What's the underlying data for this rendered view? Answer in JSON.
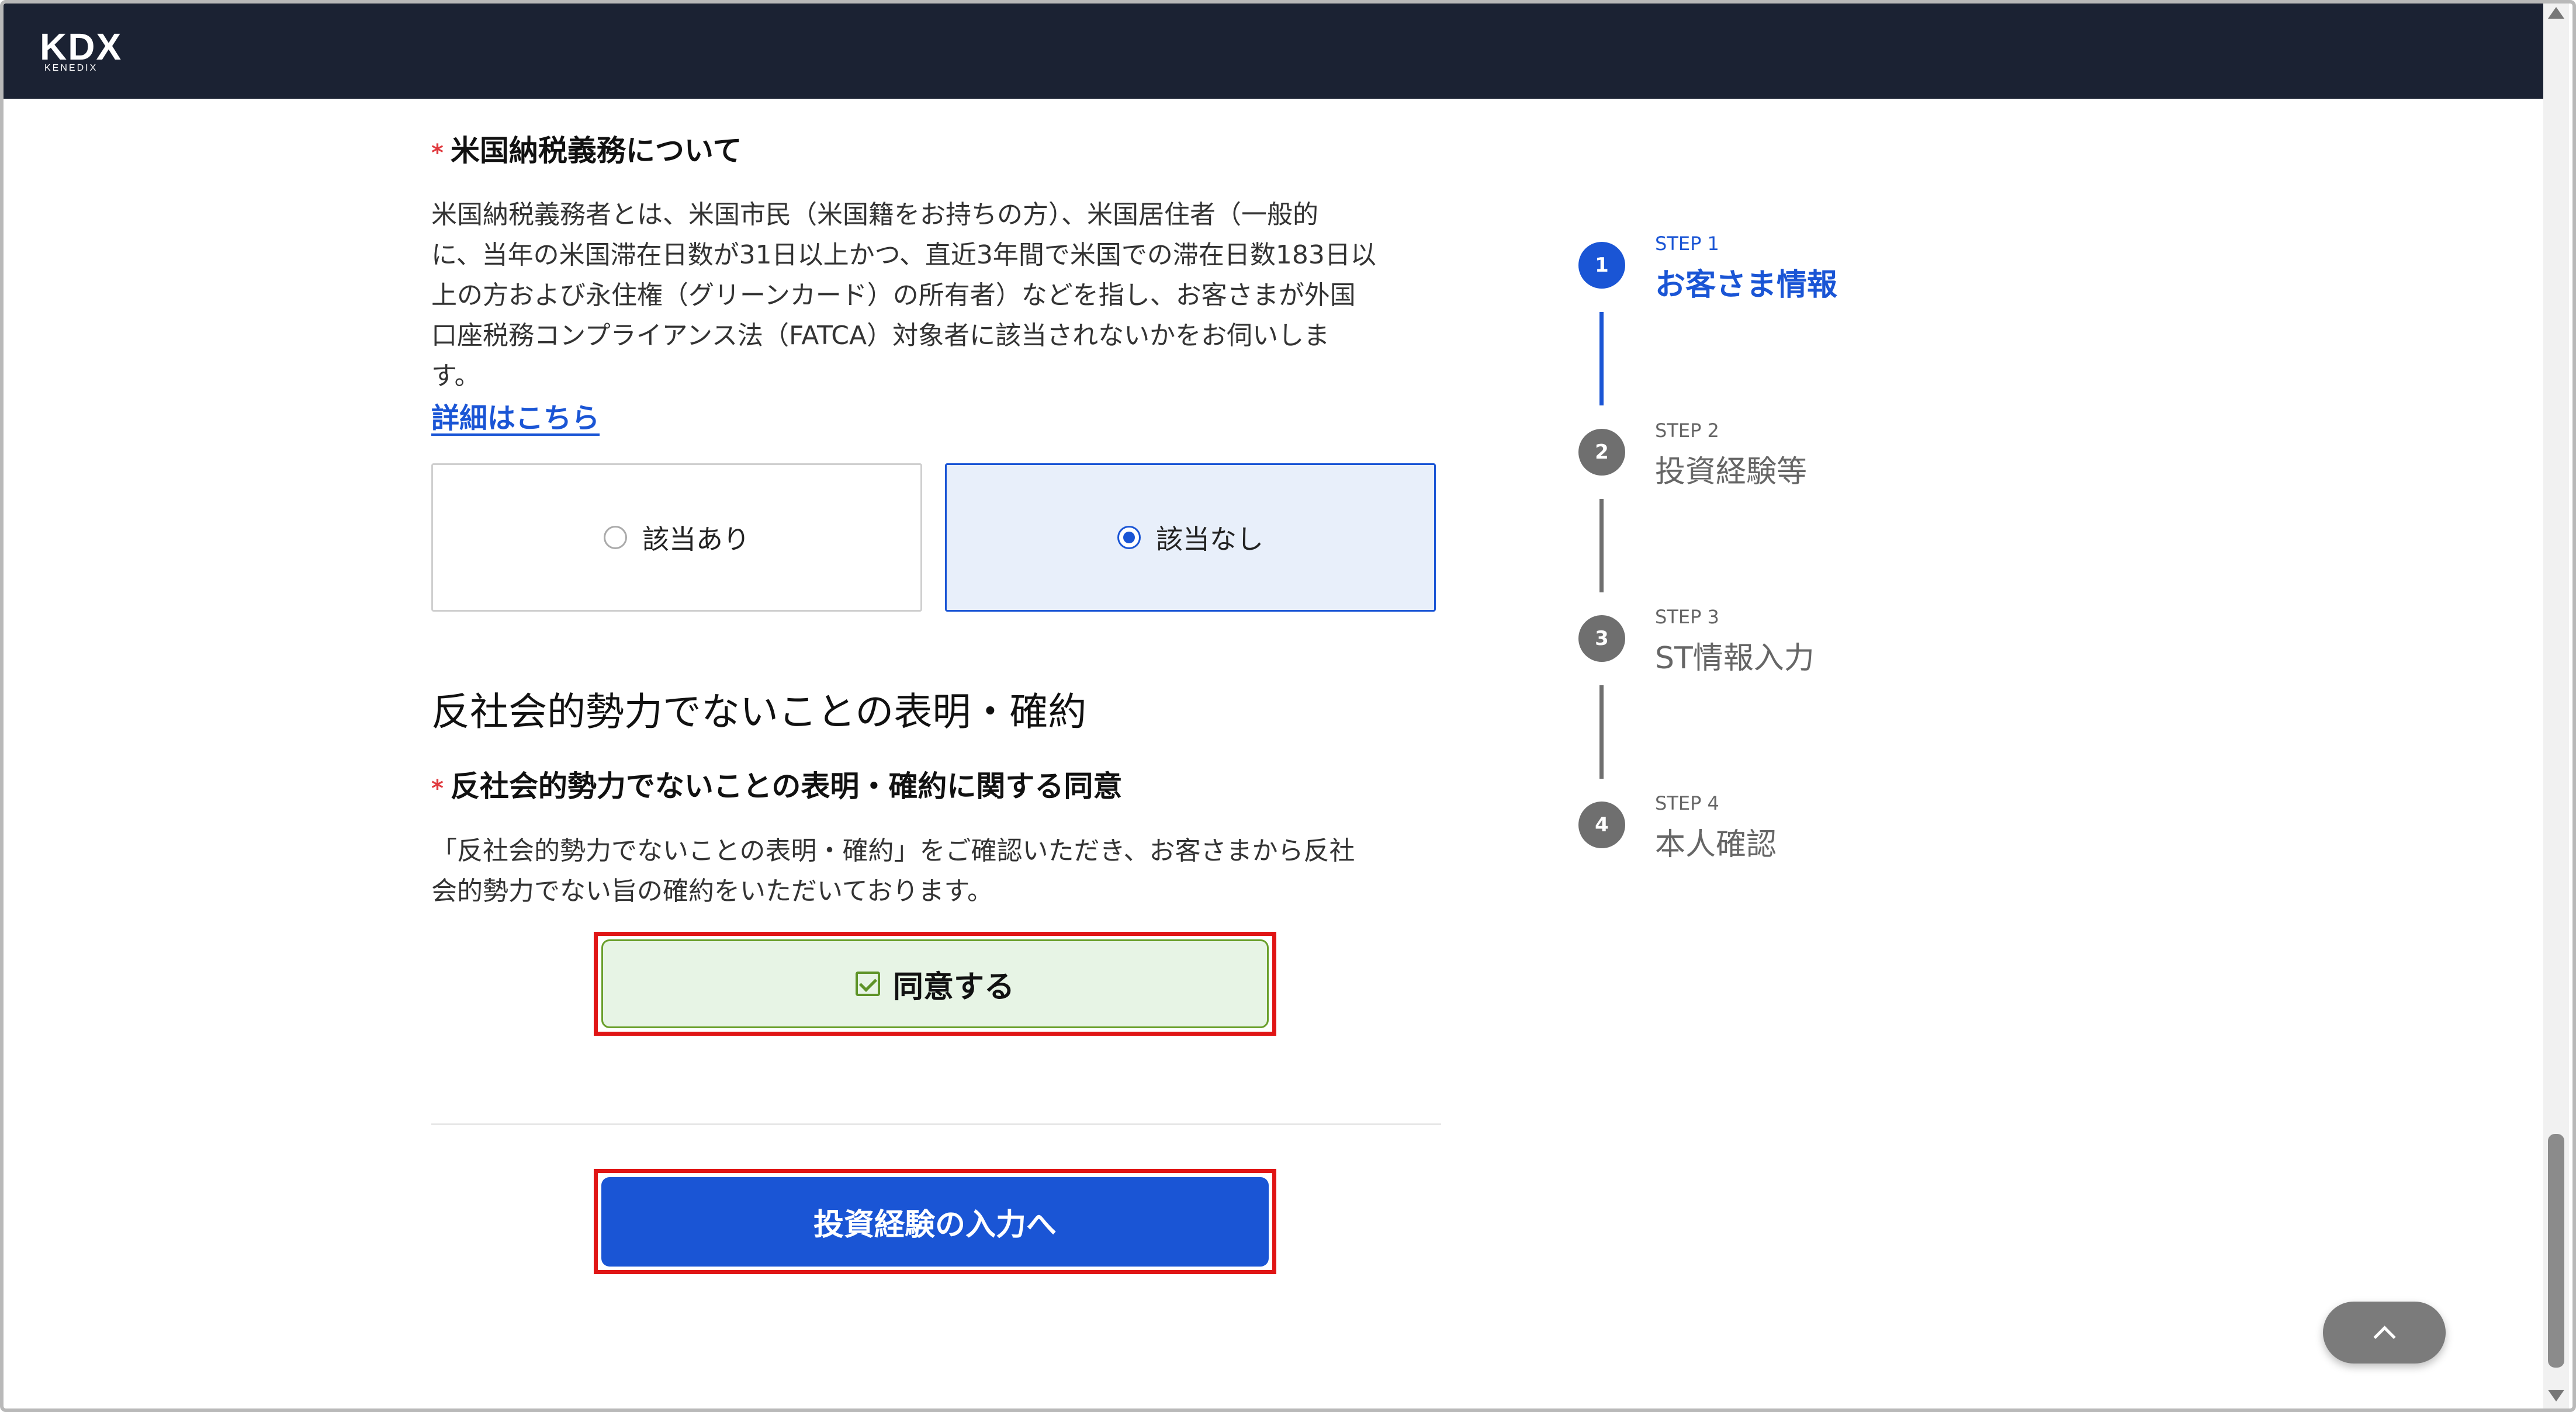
{
  "header": {
    "logo_main": "KDX",
    "logo_sub": "KENEDIX"
  },
  "fatca": {
    "required_mark": "*",
    "title": "米国納税義務について",
    "description_lines": [
      "米国納税義務者とは、米国市民（米国籍をお持ちの方）、米国居住者（一般的",
      "に、当年の米国滞在日数が31日以上かつ、直近3年間で米国での滞在日数183日以",
      "上の方および永住権（グリーンカード）の所有者）などを指し、お客さまが外国",
      "口座税務コンプライアンス法（FATCA）対象者に該当されないかをお伺いしま",
      "す。"
    ],
    "detail_link": "詳細はこちら",
    "options": [
      "該当あり",
      "該当なし"
    ],
    "selected": "該当なし"
  },
  "antisocial": {
    "heading": "反社会的勢力でないことの表明・確約",
    "required_mark": "*",
    "title": "反社会的勢力でないことの表明・確約に関する同意",
    "description_lines": [
      "「反社会的勢力でないことの表明・確約」をご確認いただき、お客さまから反社",
      "会的勢力でない旨の確約をいただいております。"
    ],
    "agree_label": "同意する",
    "agree_checked": true
  },
  "next_button": "投資経験の入力へ",
  "steps": [
    {
      "label": "STEP 1",
      "number": "1",
      "name": "お客さま情報",
      "active": true
    },
    {
      "label": "STEP 2",
      "number": "2",
      "name": "投資経験等",
      "active": false
    },
    {
      "label": "STEP 3",
      "number": "3",
      "name": "ST情報入力",
      "active": false
    },
    {
      "label": "STEP 4",
      "number": "4",
      "name": "本人確認",
      "active": false
    }
  ],
  "scroll_to_top_icon": "chevron-up-icon",
  "colors": {
    "accent": "#1a55d5",
    "header_bg": "#1b2233",
    "agree_bg": "#e7f4e5",
    "highlight_outline": "#e01515"
  }
}
